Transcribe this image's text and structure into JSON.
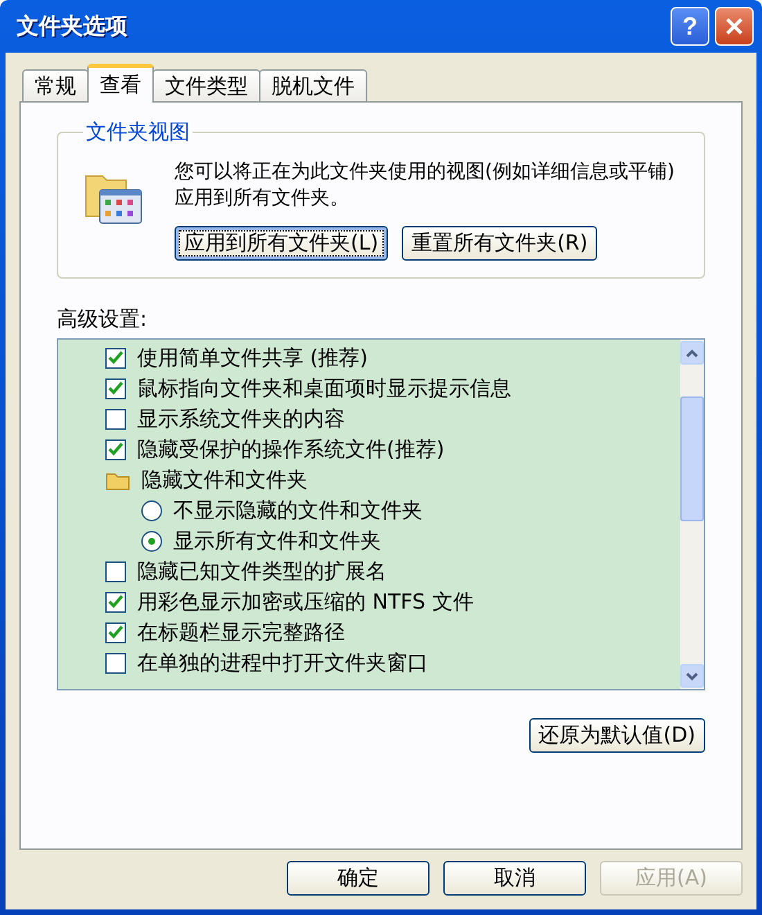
{
  "window": {
    "title": "文件夹选项",
    "help_button": "?"
  },
  "tabs": [
    {
      "label": "常规",
      "selected": false
    },
    {
      "label": "查看",
      "selected": true
    },
    {
      "label": "文件类型",
      "selected": false
    },
    {
      "label": "脱机文件",
      "selected": false
    }
  ],
  "folder_views": {
    "title": "文件夹视图",
    "description": "您可以将正在为此文件夹使用的视图(例如详细信息或平铺)应用到所有文件夹。",
    "buttons": [
      {
        "label": "应用到所有文件夹(L)",
        "focused": true
      },
      {
        "label": "重置所有文件夹(R)",
        "focused": false
      }
    ]
  },
  "advanced": {
    "label": "高级设置:",
    "items": [
      {
        "kind": "checkbox",
        "label": "使用简单文件共享 (推荐)",
        "checked": true
      },
      {
        "kind": "checkbox",
        "label": "鼠标指向文件夹和桌面项时显示提示信息",
        "checked": true
      },
      {
        "kind": "checkbox",
        "label": "显示系统文件夹的内容",
        "checked": false
      },
      {
        "kind": "checkbox",
        "label": "隐藏受保护的操作系统文件(推荐)",
        "checked": true
      },
      {
        "kind": "folder",
        "label": "隐藏文件和文件夹",
        "children": [
          {
            "kind": "radio",
            "label": "不显示隐藏的文件和文件夹",
            "selected": false
          },
          {
            "kind": "radio",
            "label": "显示所有文件和文件夹",
            "selected": true
          }
        ]
      },
      {
        "kind": "checkbox",
        "label": "隐藏已知文件类型的扩展名",
        "checked": false
      },
      {
        "kind": "checkbox",
        "label": "用彩色显示加密或压缩的 NTFS 文件",
        "checked": true
      },
      {
        "kind": "checkbox",
        "label": "在标题栏显示完整路径",
        "checked": true
      },
      {
        "kind": "checkbox",
        "label": "在单独的进程中打开文件夹窗口",
        "checked": false
      }
    ],
    "restore_button": "还原为默认值(D)"
  },
  "buttons": [
    {
      "label": "确定",
      "disabled": false
    },
    {
      "label": "取消",
      "disabled": false
    },
    {
      "label": "应用(A)",
      "disabled": true
    }
  ]
}
